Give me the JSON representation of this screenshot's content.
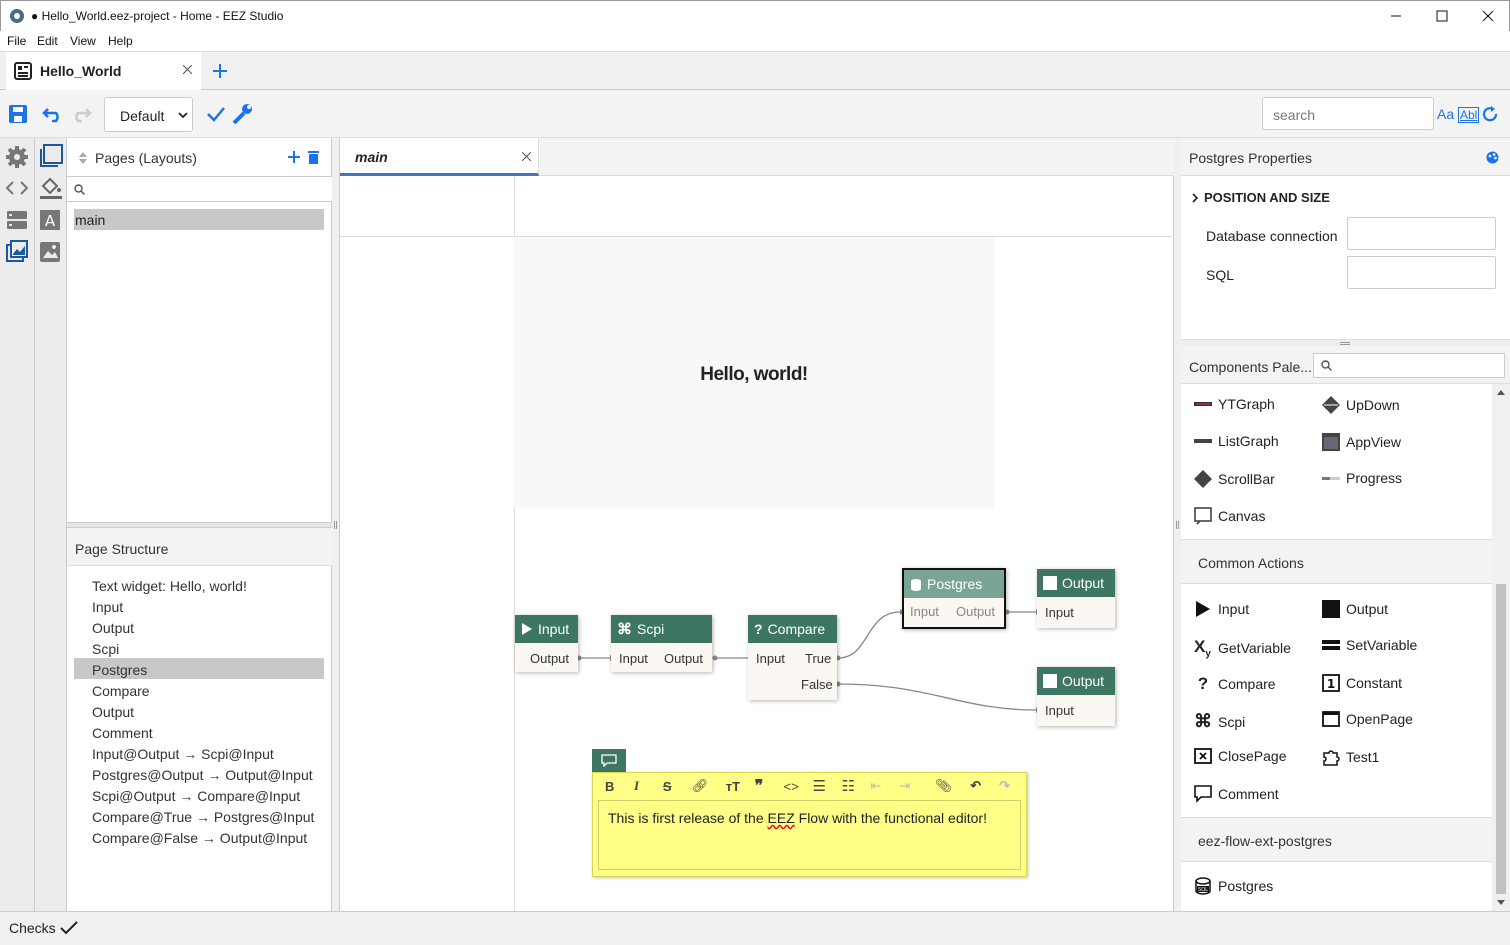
{
  "window": {
    "title": "● Hello_World.eez-project - Home - EEZ Studio"
  },
  "menu": [
    "File",
    "Edit",
    "View",
    "Help"
  ],
  "tabs": {
    "active": "Hello_World"
  },
  "toolbar": {
    "config_value": "Default",
    "search_placeholder": "search",
    "aa": "Aa",
    "abl": "Abl"
  },
  "pages": {
    "title": "Pages (Layouts)",
    "items": [
      "main"
    ]
  },
  "structure": {
    "title": "Page Structure",
    "items": [
      "Text widget: Hello, world!",
      "Input",
      "Output",
      "Scpi",
      "Postgres",
      "Compare",
      "Output",
      "Comment",
      "Input@Output → Scpi@Input",
      "Postgres@Output → Output@Input",
      "Scpi@Output → Compare@Input",
      "Compare@True → Postgres@Input",
      "Compare@False → Output@Input"
    ],
    "selected": 4
  },
  "editor": {
    "tab": "main",
    "hello_text": "Hello, world!",
    "nodes": {
      "input": {
        "title": "Input",
        "out": "Output"
      },
      "scpi": {
        "title": "Scpi",
        "in": "Input",
        "out": "Output"
      },
      "compare": {
        "title": "Compare",
        "in": "Input",
        "true": "True",
        "false": "False"
      },
      "postgres": {
        "title": "Postgres",
        "in": "Input",
        "out": "Output"
      },
      "output1": {
        "title": "Output",
        "in": "Input"
      },
      "output2": {
        "title": "Output",
        "in": "Input"
      }
    },
    "comment": {
      "text_before": "This is first release of the ",
      "text_err": "EEZ",
      "text_after": " Flow with the functional editor!"
    }
  },
  "properties": {
    "title": "Postgres Properties",
    "section": "POSITION AND SIZE",
    "fields": [
      {
        "label": "Database connection",
        "value": ""
      },
      {
        "label": "SQL",
        "value": ""
      }
    ]
  },
  "palette": {
    "title": "Components Pale...",
    "widgets": [
      "YTGraph",
      "UpDown",
      "ListGraph",
      "AppView",
      "ScrollBar",
      "Progress",
      "Canvas"
    ],
    "common_title": "Common Actions",
    "actions": [
      "Input",
      "Output",
      "GetVariable",
      "SetVariable",
      "Compare",
      "Constant",
      "Scpi",
      "OpenPage",
      "ClosePage",
      "Test1",
      "Comment"
    ],
    "ext_title": "eez-flow-ext-postgres",
    "ext_items": [
      "Postgres"
    ]
  },
  "status": {
    "checks": "Checks"
  },
  "colors": {
    "node_header": "#3e7664",
    "accent": "#1a73e8",
    "comment_bg": "#ffff88",
    "selection": "#c8c8c8"
  }
}
